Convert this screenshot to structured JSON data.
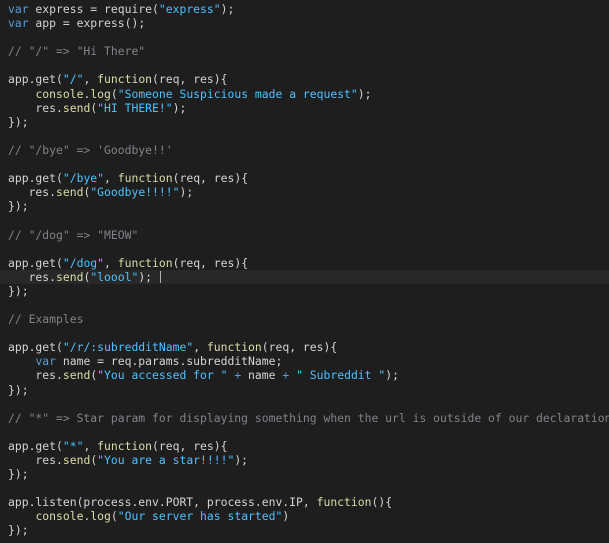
{
  "colors": {
    "background": "#1e1e1e",
    "current_line": "#282828",
    "keyword": "#569cd6",
    "string": "#4fc1ff",
    "function": "#dcdcaa",
    "comment": "#7f8389",
    "text": "#d4d4d4"
  },
  "editor": {
    "current_line_index": 19,
    "lines": [
      [
        [
          "kw",
          "var"
        ],
        [
          "txt",
          " express = "
        ],
        [
          "txt",
          "require("
        ],
        [
          "str",
          "\"express\""
        ],
        [
          "txt",
          ");"
        ]
      ],
      [
        [
          "kw",
          "var"
        ],
        [
          "txt",
          " app = "
        ],
        [
          "txt",
          "express();"
        ]
      ],
      [],
      [
        [
          "cmt",
          "// \"/\" => \"Hi There\""
        ]
      ],
      [],
      [
        [
          "txt",
          "app.get("
        ],
        [
          "str",
          "\"/\""
        ],
        [
          "txt",
          ", "
        ],
        [
          "fn",
          "function"
        ],
        [
          "txt",
          "(req, res){"
        ]
      ],
      [
        [
          "txt",
          "    "
        ],
        [
          "fn",
          "console"
        ],
        [
          "txt",
          "."
        ],
        [
          "fn",
          "log"
        ],
        [
          "txt",
          "("
        ],
        [
          "str",
          "\"Someone Suspicious made a request\""
        ],
        [
          "txt",
          ");"
        ]
      ],
      [
        [
          "txt",
          "    res."
        ],
        [
          "fn",
          "send"
        ],
        [
          "txt",
          "("
        ],
        [
          "str",
          "\"HI THERE!\""
        ],
        [
          "txt",
          ");"
        ]
      ],
      [
        [
          "txt",
          "});"
        ]
      ],
      [],
      [
        [
          "cmt",
          "// \"/bye\" => 'Goodbye!!'"
        ]
      ],
      [],
      [
        [
          "txt",
          "app.get("
        ],
        [
          "str",
          "\"/bye\""
        ],
        [
          "txt",
          ", "
        ],
        [
          "fn",
          "function"
        ],
        [
          "txt",
          "(req, res){"
        ]
      ],
      [
        [
          "txt",
          "   res."
        ],
        [
          "fn",
          "send"
        ],
        [
          "txt",
          "("
        ],
        [
          "str",
          "\"Goodbye!!!!\""
        ],
        [
          "txt",
          ");"
        ]
      ],
      [
        [
          "txt",
          "});"
        ]
      ],
      [],
      [
        [
          "cmt",
          "// \"/dog\" => \"MEOW\""
        ]
      ],
      [],
      [
        [
          "txt",
          "app.get("
        ],
        [
          "str",
          "\"/dog\""
        ],
        [
          "txt",
          ", "
        ],
        [
          "fn",
          "function"
        ],
        [
          "txt",
          "(req, res){"
        ]
      ],
      [
        [
          "txt",
          "   res."
        ],
        [
          "fn",
          "send"
        ],
        [
          "txt",
          "("
        ],
        [
          "str",
          "\"loool\""
        ],
        [
          "txt",
          ");"
        ]
      ],
      [
        [
          "txt",
          "});"
        ]
      ],
      [],
      [
        [
          "cmt",
          "// Examples"
        ]
      ],
      [],
      [
        [
          "txt",
          "app.get("
        ],
        [
          "str",
          "\"/r/:subredditName\""
        ],
        [
          "txt",
          ", "
        ],
        [
          "fn",
          "function"
        ],
        [
          "txt",
          "(req, res){"
        ]
      ],
      [
        [
          "txt",
          "    "
        ],
        [
          "kw",
          "var"
        ],
        [
          "txt",
          " name = req.params.subredditName;"
        ]
      ],
      [
        [
          "txt",
          "    res."
        ],
        [
          "fn",
          "send"
        ],
        [
          "txt",
          "("
        ],
        [
          "str",
          "\"You accessed for \""
        ],
        [
          "txt",
          " "
        ],
        [
          "kw",
          "+"
        ],
        [
          "txt",
          " name "
        ],
        [
          "kw",
          "+"
        ],
        [
          "txt",
          " "
        ],
        [
          "str",
          "\" Subreddit \""
        ],
        [
          "txt",
          ");"
        ]
      ],
      [
        [
          "txt",
          "});"
        ]
      ],
      [],
      [
        [
          "cmt",
          "// \"*\" => Star param for displaying something when the url is outside of our declaration"
        ]
      ],
      [],
      [
        [
          "txt",
          "app.get("
        ],
        [
          "str",
          "\"*\""
        ],
        [
          "txt",
          ", "
        ],
        [
          "fn",
          "function"
        ],
        [
          "txt",
          "(req, res){"
        ]
      ],
      [
        [
          "txt",
          "    res."
        ],
        [
          "fn",
          "send"
        ],
        [
          "txt",
          "("
        ],
        [
          "str",
          "\"You are a star!!!!\""
        ],
        [
          "txt",
          ");"
        ]
      ],
      [
        [
          "txt",
          "});"
        ]
      ],
      [],
      [
        [
          "txt",
          "app.listen(process.env.PORT, process.env.IP, "
        ],
        [
          "fn",
          "function"
        ],
        [
          "txt",
          "(){"
        ]
      ],
      [
        [
          "txt",
          "    "
        ],
        [
          "fn",
          "console"
        ],
        [
          "txt",
          "."
        ],
        [
          "fn",
          "log"
        ],
        [
          "txt",
          "("
        ],
        [
          "str",
          "\"Our server has started\""
        ],
        [
          "txt",
          ")"
        ]
      ],
      [
        [
          "txt",
          "});"
        ]
      ]
    ]
  }
}
